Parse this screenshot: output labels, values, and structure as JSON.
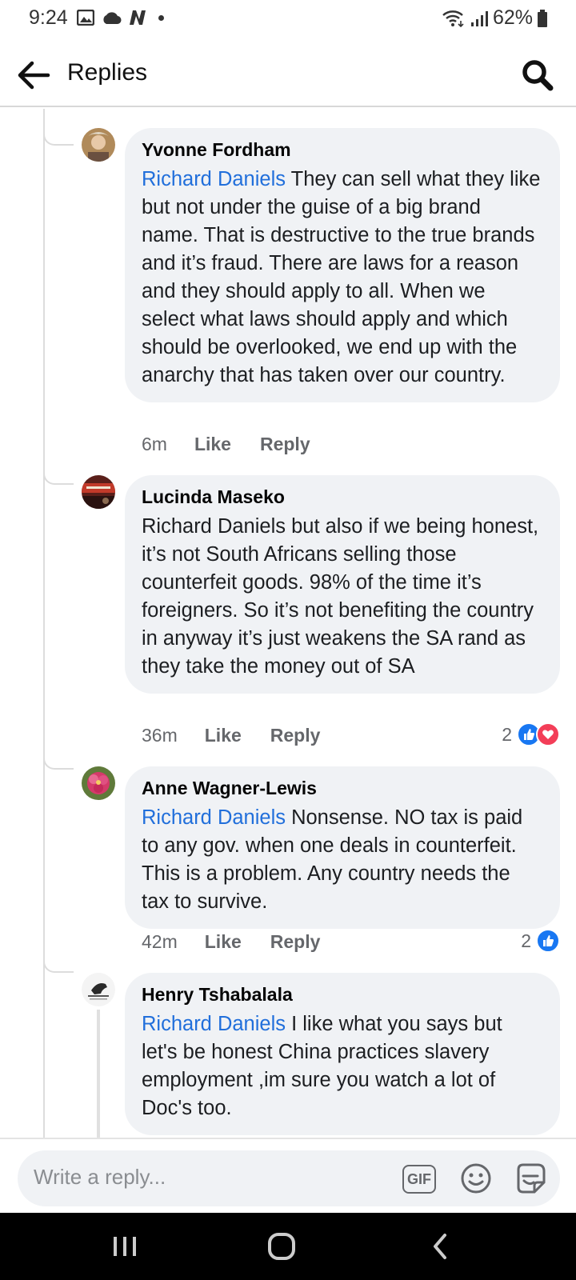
{
  "status_bar": {
    "time": "9:24",
    "battery": "62%"
  },
  "header": {
    "title": "Replies"
  },
  "comments": [
    {
      "author": "Yvonne Fordham",
      "mention": "Richard Daniels",
      "text": " They can sell what they like but not under the guise of a big brand name. That is destructive to the true brands and it’s fraud. There are laws for a reason and they should apply to all. When we select what laws should apply and which should be overlooked, we end up with the anarchy that has taken over our country.",
      "time": "6m",
      "like_label": "Like",
      "reply_label": "Reply",
      "reaction_count": ""
    },
    {
      "author": "Lucinda Maseko",
      "mention": "",
      "text": "Richard Daniels but also if we being honest, it’s not South Africans selling those counterfeit goods. 98% of the time it’s foreigners. So it’s not benefiting the country in anyway it’s just weakens the SA rand as they take the money out of SA",
      "time": "36m",
      "like_label": "Like",
      "reply_label": "Reply",
      "reaction_count": "2"
    },
    {
      "author": "Anne Wagner-Lewis",
      "mention": "Richard Daniels",
      "text": " Nonsense. NO tax is paid to any gov. when one deals in counterfeit. This is a problem. Any country needs the tax to survive.",
      "time": "42m",
      "like_label": "Like",
      "reply_label": "Reply",
      "reaction_count": "2"
    },
    {
      "author": "Henry Tshabalala",
      "mention": "Richard Daniels",
      "text": " I like what you says but let's be honest China practices slavery employment ,im sure you watch a lot of Doc's too.",
      "time": "",
      "like_label": "",
      "reply_label": "",
      "reaction_count": ""
    }
  ],
  "reply_bar": {
    "placeholder": "Write a reply...",
    "gif_label": "GIF"
  },
  "icons": {
    "back": "arrow-left-icon",
    "search": "search-icon",
    "like_reaction": "thumbs-up-icon",
    "love_reaction": "heart-icon",
    "emoji": "smiley-icon",
    "sticker": "sticker-icon"
  },
  "colors": {
    "mention": "#216fdb",
    "bubble": "#f0f2f5",
    "like": "#1877f2",
    "love": "#f33e58"
  }
}
